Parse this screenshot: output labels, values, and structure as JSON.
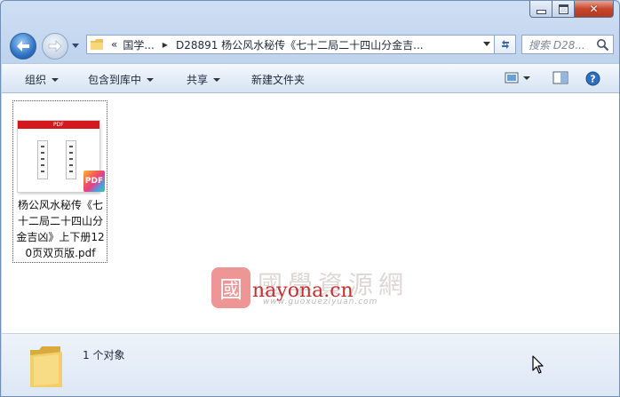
{
  "window": {
    "min_icon": "minimize-icon",
    "max_icon": "maximize-icon",
    "close_icon": "close-icon",
    "close_glyph": "✕"
  },
  "nav": {
    "back_icon": "back-arrow-icon",
    "forward_icon": "forward-arrow-icon",
    "breadcrumb_prefix": "«",
    "breadcrumbs": [
      "国学...",
      "D28891 杨公风水秘传《七十二局二十四山分金吉..."
    ],
    "search_placeholder": "搜索 D28...",
    "refresh_icon": "refresh-icon",
    "search_icon": "search-icon"
  },
  "toolbar": {
    "organize": "组织",
    "include_in_library": "包含到库中",
    "share": "共享",
    "new_folder": "新建文件夹",
    "view_icon": "view-options-icon",
    "preview_icon": "preview-pane-icon",
    "help_icon": "help-icon"
  },
  "files": [
    {
      "name": "杨公风水秘传《七十二局二十四山分金吉凶》上下册120页双页版.pdf",
      "thumb_band_text": "PDF",
      "badge": "PDF"
    }
  ],
  "watermark": {
    "seal_char": "國",
    "big_text": "國學資源網",
    "domain": "nayona.cn",
    "url": "www.guoxueziyuan.com"
  },
  "status": {
    "count_text": "1 个对象"
  },
  "colors": {
    "accent": "#2f73c4",
    "pdf_band": "#d3181e",
    "close_button": "#c8462d"
  }
}
